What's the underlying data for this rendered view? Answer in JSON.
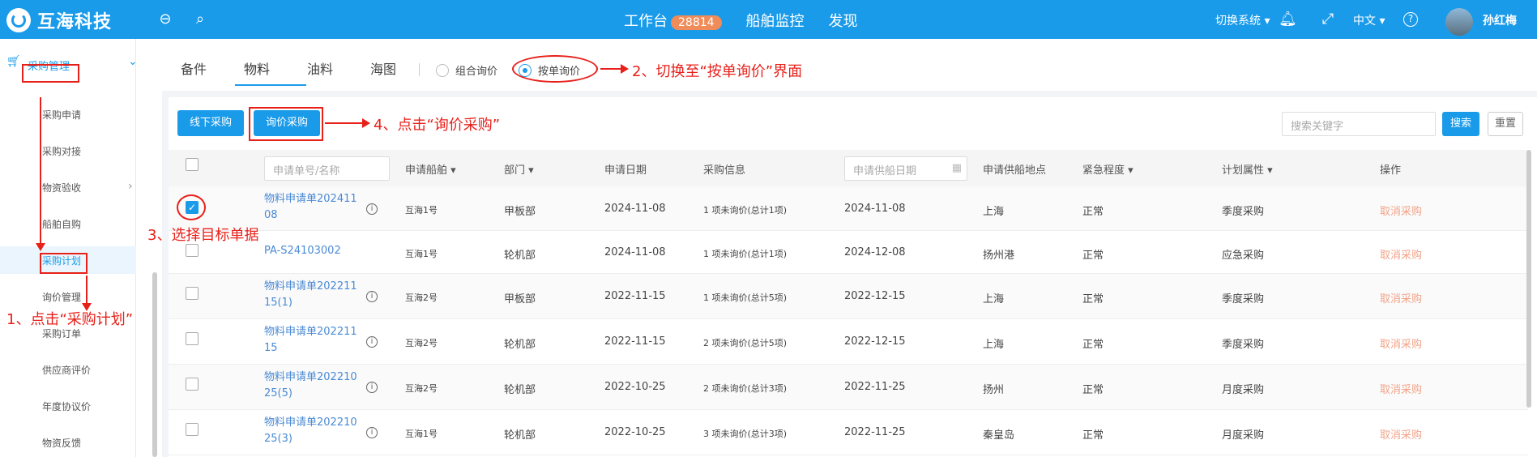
{
  "header": {
    "brand": "互海科技",
    "nav": [
      "工作台",
      "船舶监控",
      "发现"
    ],
    "workbench_count": "28814",
    "switch_system": "切换系统",
    "language": "中文",
    "user_name": "孙红梅"
  },
  "sidebar": {
    "title": "采购管理",
    "items": [
      "采购申请",
      "采购对接",
      "物资验收",
      "船舶自购",
      "采购计划",
      "询价管理",
      "采购订单",
      "供应商评价",
      "年度协议价",
      "物资反馈"
    ]
  },
  "tabs": [
    "备件",
    "物料",
    "油料",
    "海图"
  ],
  "radios": [
    "组合询价",
    "按单询价"
  ],
  "toolbar": {
    "offline_purchase": "线下采购",
    "inquiry_purchase": "询价采购",
    "search_placeholder": "搜索关键字",
    "search_button": "搜索",
    "reset_button": "重置"
  },
  "table": {
    "headers": {
      "no_placeholder": "申请单号/名称",
      "ship": "申请船舶",
      "dept": "部门",
      "date": "申请日期",
      "info": "采购信息",
      "supply_date_placeholder": "申请供船日期",
      "location": "申请供船地点",
      "urgency": "紧急程度",
      "attr": "计划属性",
      "action": "操作"
    },
    "rows": [
      {
        "no1": "物料申请单202411",
        "no2": "08",
        "ship": "互海1号",
        "dept": "甲板部",
        "date": "2024-11-08",
        "info": "1 项未询价(总计1项)",
        "supply": "2024-11-08",
        "loc": "上海",
        "urgency": "正常",
        "attr": "季度采购",
        "action": "取消采购"
      },
      {
        "no1": "PA-S24103002",
        "no2": "",
        "ship": "互海1号",
        "dept": "轮机部",
        "date": "2024-11-08",
        "info": "1 项未询价(总计1项)",
        "supply": "2024-12-08",
        "loc": "扬州港",
        "urgency": "正常",
        "attr": "应急采购",
        "action": "取消采购"
      },
      {
        "no1": "物料申请单202211",
        "no2": "15(1)",
        "ship": "互海2号",
        "dept": "甲板部",
        "date": "2022-11-15",
        "info": "1 项未询价(总计5项)",
        "supply": "2022-12-15",
        "loc": "上海",
        "urgency": "正常",
        "attr": "季度采购",
        "action": "取消采购"
      },
      {
        "no1": "物料申请单202211",
        "no2": "15",
        "ship": "互海2号",
        "dept": "轮机部",
        "date": "2022-11-15",
        "info": "2 项未询价(总计5项)",
        "supply": "2022-12-15",
        "loc": "上海",
        "urgency": "正常",
        "attr": "季度采购",
        "action": "取消采购"
      },
      {
        "no1": "物料申请单202210",
        "no2": "25(5)",
        "ship": "互海2号",
        "dept": "轮机部",
        "date": "2022-10-25",
        "info": "2 项未询价(总计3项)",
        "supply": "2022-11-25",
        "loc": "扬州",
        "urgency": "正常",
        "attr": "月度采购",
        "action": "取消采购"
      },
      {
        "no1": "物料申请单202210",
        "no2": "25(3)",
        "ship": "互海1号",
        "dept": "轮机部",
        "date": "2022-10-25",
        "info": "3 项未询价(总计3项)",
        "supply": "2022-11-25",
        "loc": "秦皇岛",
        "urgency": "正常",
        "attr": "月度采购",
        "action": "取消采购"
      }
    ]
  },
  "annotations": {
    "step1": "1、点击“采购计划”",
    "step2": "2、切换至“按单询价”界面",
    "step3": "3、选择目标单据",
    "step4": "4、点击“询价采购”"
  },
  "colors": {
    "primary": "#1a9bea",
    "annotation": "#e8201a",
    "cancel": "#f2a388"
  }
}
